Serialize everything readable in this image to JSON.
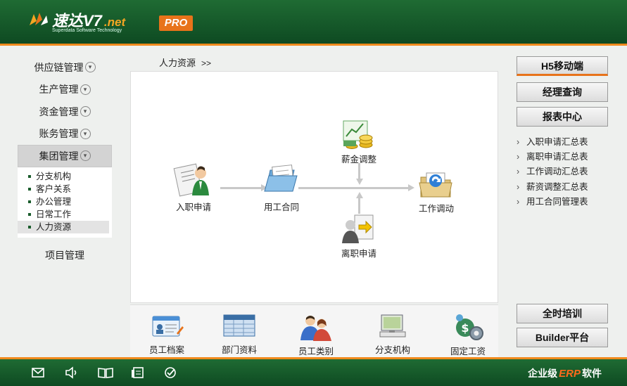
{
  "header": {
    "brand": "速达V7",
    "brand_suffix": ".net",
    "tagline": "Superdata Software Technology",
    "edition": "PRO",
    "colors": {
      "green": "#1a5c2c",
      "orange": "#f08a1c"
    }
  },
  "nav": {
    "items": [
      {
        "label": "供应链管理"
      },
      {
        "label": "生产管理"
      },
      {
        "label": "资金管理"
      },
      {
        "label": "账务管理"
      },
      {
        "label": "集团管理"
      }
    ],
    "submenu": [
      {
        "label": "分支机构"
      },
      {
        "label": "客户关系"
      },
      {
        "label": "办公管理"
      },
      {
        "label": "日常工作"
      },
      {
        "label": "人力资源"
      }
    ],
    "project": "项目管理"
  },
  "breadcrumb": {
    "label": "人力资源",
    "sep": ">>"
  },
  "flow": {
    "hire": "入职申请",
    "contract": "用工合同",
    "salary": "薪金调整",
    "resign": "离职申请",
    "transfer": "工作调动"
  },
  "tools": [
    {
      "label": "员工档案",
      "icon": "id-card-icon"
    },
    {
      "label": "部门资料",
      "icon": "grid-icon"
    },
    {
      "label": "员工类别",
      "icon": "people-icon"
    },
    {
      "label": "分支机构",
      "icon": "monitor-icon"
    },
    {
      "label": "固定工资",
      "icon": "money-gear-icon"
    }
  ],
  "right": {
    "h5": "H5移动端",
    "manager": "经理查询",
    "reports": "报表中心",
    "links": [
      "入职申请汇总表",
      "离职申请汇总表",
      "工作调动汇总表",
      "薪资调整汇总表",
      "用工合同管理表"
    ],
    "training": "全时培训",
    "builder": "Builder平台"
  },
  "footer": {
    "text_left": "企业级",
    "text_erp": "ERP",
    "text_right": "软件",
    "icons": [
      "mail-icon",
      "speaker-icon",
      "book-icon",
      "document-icon",
      "check-icon"
    ]
  }
}
